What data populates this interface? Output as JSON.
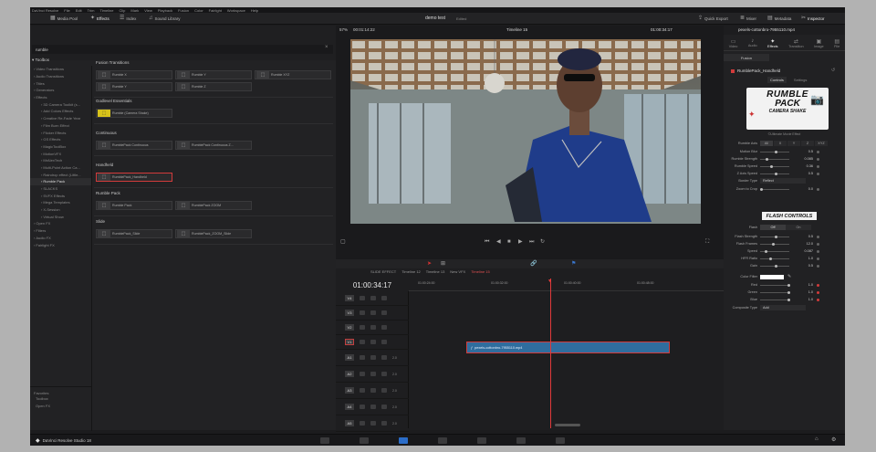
{
  "menubar": [
    "DaVinci Resolve",
    "File",
    "Edit",
    "Trim",
    "Timeline",
    "Clip",
    "Mark",
    "View",
    "Playback",
    "Fusion",
    "Color",
    "Fairlight",
    "Workspace",
    "Help"
  ],
  "toolbar": {
    "media_pool": "Media Pool",
    "effects": "Effects",
    "index": "Index",
    "sound_library": "Sound Library",
    "project": "demo test",
    "edited": "Edited",
    "quick_export": "Quick Export",
    "mixer": "Mixer",
    "metadata": "Metadata",
    "inspector": "Inspector"
  },
  "viewer": {
    "zoom": "57%",
    "timecode_left": "00:01:14:22",
    "timeline_name": "Timeline 15",
    "timecode_right": "01:00:34:17"
  },
  "effects": {
    "search": "rumble",
    "toolbox_label": "Toolbox",
    "tree": [
      "Video Transitions",
      "Audio Transitions",
      "Titles",
      "Generators",
      "Effects",
      "3D Camera Toolkit (s...",
      "Add Colors Effects",
      "Creative Re-Fade Year",
      "Film Burn Effect",
      "Flicker Effects",
      "GS Effects",
      "MagicToolBox",
      "MotionVFX",
      "MrAlexTech",
      "Multi-Point Action Ca...",
      "Raindrop effect (Little...",
      "Rumble Pack",
      "SLACKS",
      "SVFX Effects",
      "Mega Templates",
      "X-Session",
      "Virtual Show",
      "Open FX",
      "Filters",
      "Audio FX",
      "Fairlight FX"
    ],
    "favorites": "Favorites",
    "fav_items": [
      "Toolbox",
      "Open FX"
    ],
    "sections": [
      {
        "title": "Fusion Transitions",
        "items": [
          "Rumble X",
          "Rumble Y",
          "Rumble XYZ",
          "Rumble Y",
          "Rumble Z"
        ]
      },
      {
        "title": "Godlevel Essentials",
        "items": [
          "Rumble (Camera Shake)"
        ]
      },
      {
        "title": "Continuous",
        "items": [
          "RumblePack Continuous",
          "RumblePack Continuous Z..."
        ]
      },
      {
        "title": "Handheld",
        "items": [
          "RumblePack_Handheld"
        ]
      },
      {
        "title": "Rumble Pack",
        "items": [
          "Rumble Pack",
          "RumblePack ZOOM"
        ]
      },
      {
        "title": "Slide",
        "items": [
          "RumblePack_Slide",
          "RumblePack_ZOOM_Slide"
        ]
      }
    ]
  },
  "timeline": {
    "tabs": [
      "SLIDE EFFECT",
      "Timeline 12",
      "Timeline 13",
      "New VFX",
      "Timeline 15"
    ],
    "timecode": "01:00:34:17",
    "ruler": [
      "01:00:24:00",
      "01:00:32:00",
      "01:00:40:00",
      "01:00:48:00"
    ],
    "video_tracks": [
      "V4",
      "V3",
      "V2",
      "V1"
    ],
    "audio_tracks": [
      "A1",
      "A2",
      "A3",
      "A4",
      "A5"
    ],
    "audio_vals": [
      "2.0",
      "2.0",
      "2.0",
      "2.0",
      "2.0"
    ],
    "clip": "pexels-cottonbro-7955110.mp4"
  },
  "inspector": {
    "file": "pexels-cottonbro-7955110.mp4",
    "tabs": [
      "Video",
      "Audio",
      "Effects",
      "Transition",
      "Image",
      "File"
    ],
    "fusion": "Fusion",
    "name": "RumblePack_Handheld",
    "sub_tabs": [
      "Controls",
      "Settings"
    ],
    "logo_line1": "RUMBLE",
    "logo_line2": "PACK",
    "logo_line3": "CAMERA SHAKE",
    "logo_sub": "©Ultimate Movie Effect",
    "rumble_axis": {
      "label": "Rumble Axis",
      "opts": [
        "All",
        "X",
        "Y",
        "Z",
        "XYZ"
      ]
    },
    "params1": [
      {
        "label": "Motion Blur",
        "val": "0.5"
      },
      {
        "label": "Rumble Strength",
        "val": "0.085"
      },
      {
        "label": "Rumble Speed",
        "val": "0.36"
      },
      {
        "label": "Z Axis Speed",
        "val": "0.5"
      }
    ],
    "border_type": {
      "label": "Border Type",
      "val": "Reflect"
    },
    "zoom_crop": {
      "label": "Zoom to Crop",
      "val": "0.0"
    },
    "flash_title": "FLASH CONTROLS",
    "flash_toggle": {
      "label": "Flash",
      "opts": [
        "Off",
        "On"
      ]
    },
    "params2": [
      {
        "label": "Flash Strength",
        "val": "0.5"
      },
      {
        "label": "Flash Frames",
        "val": "12.0"
      },
      {
        "label": "Speed",
        "val": "0.087"
      },
      {
        "label": "HFR Ratio",
        "val": "1.0"
      },
      {
        "label": "Gain",
        "val": "0.5"
      }
    ],
    "color_label": "Color Filter",
    "rgb": [
      {
        "label": "Red",
        "val": "1.0"
      },
      {
        "label": "Green",
        "val": "1.0"
      },
      {
        "label": "Blue",
        "val": "1.0"
      }
    ],
    "composite": {
      "label": "Composite Type",
      "val": "Add"
    }
  },
  "status": {
    "app": "DaVinci Resolve Studio 18"
  },
  "colors": {
    "accent_red": "#d23b3b",
    "clip_blue": "#2f6d9e",
    "playhead": "#e03a3a"
  }
}
